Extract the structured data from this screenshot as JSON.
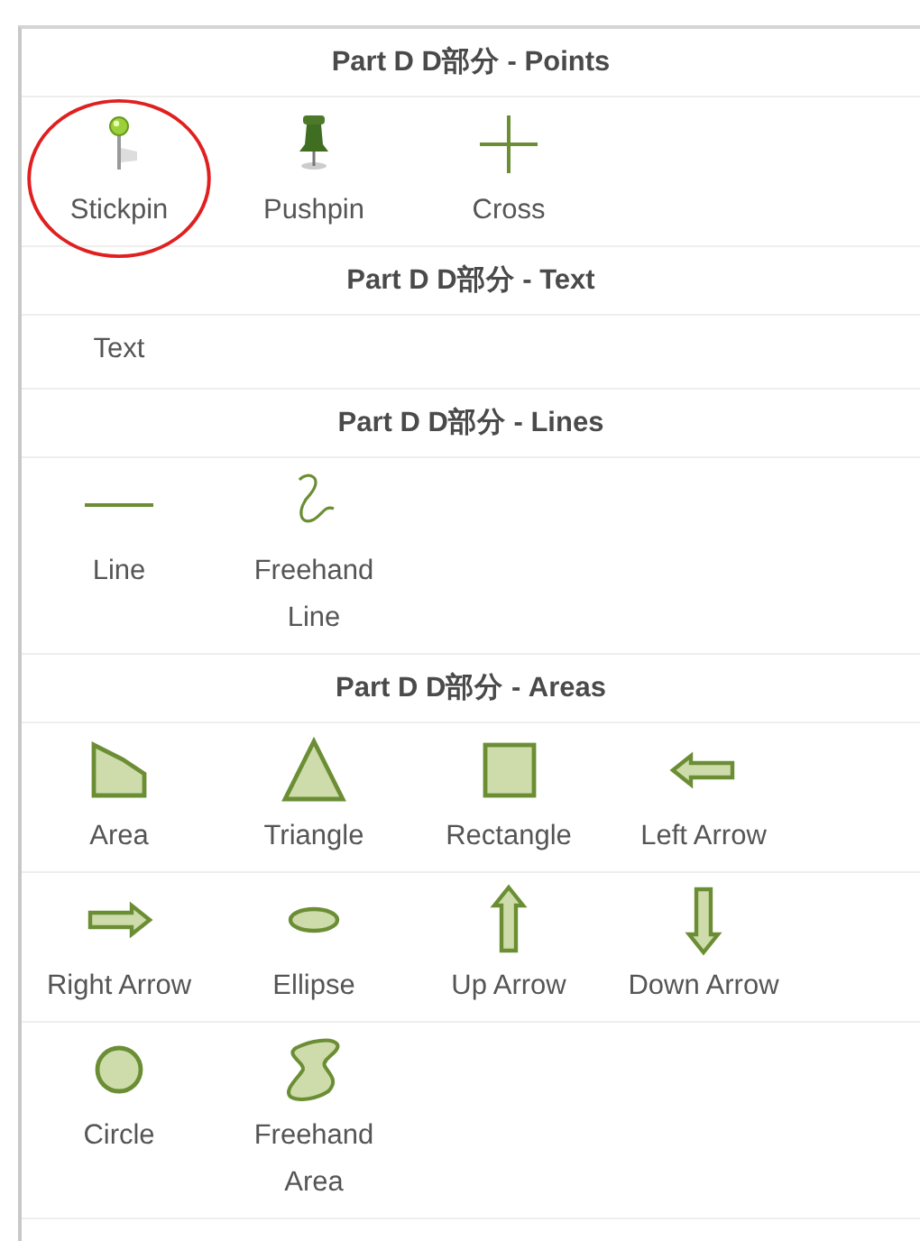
{
  "sections": [
    {
      "title": "Part D D部分 - Points",
      "rows": [
        [
          {
            "label": "Stickpin",
            "kind": "stickpin",
            "highlighted": true
          },
          {
            "label": "Pushpin",
            "kind": "pushpin",
            "highlighted": false
          },
          {
            "label": "Cross",
            "kind": "cross",
            "highlighted": false
          }
        ]
      ]
    },
    {
      "title": "Part D D部分 - Text",
      "rows": [
        [
          {
            "label": "Text",
            "kind": "text",
            "highlighted": false
          }
        ]
      ]
    },
    {
      "title": "Part D D部分 - Lines",
      "rows": [
        [
          {
            "label": "Line",
            "kind": "line",
            "highlighted": false
          },
          {
            "label": "Freehand Line",
            "kind": "freehand-line",
            "highlighted": false
          }
        ]
      ]
    },
    {
      "title": "Part D D部分 - Areas",
      "rows": [
        [
          {
            "label": "Area",
            "kind": "area",
            "highlighted": false
          },
          {
            "label": "Triangle",
            "kind": "triangle",
            "highlighted": false
          },
          {
            "label": "Rectangle",
            "kind": "rectangle",
            "highlighted": false
          },
          {
            "label": "Left Arrow",
            "kind": "left-arrow",
            "highlighted": false
          }
        ],
        [
          {
            "label": "Right Arrow",
            "kind": "right-arrow",
            "highlighted": false
          },
          {
            "label": "Ellipse",
            "kind": "ellipse",
            "highlighted": false
          },
          {
            "label": "Up Arrow",
            "kind": "up-arrow",
            "highlighted": false
          },
          {
            "label": "Down Arrow",
            "kind": "down-arrow",
            "highlighted": false
          }
        ],
        [
          {
            "label": "Circle",
            "kind": "circle",
            "highlighted": false
          },
          {
            "label": "Freehand Area",
            "kind": "freehand-area",
            "highlighted": false
          }
        ]
      ]
    }
  ]
}
